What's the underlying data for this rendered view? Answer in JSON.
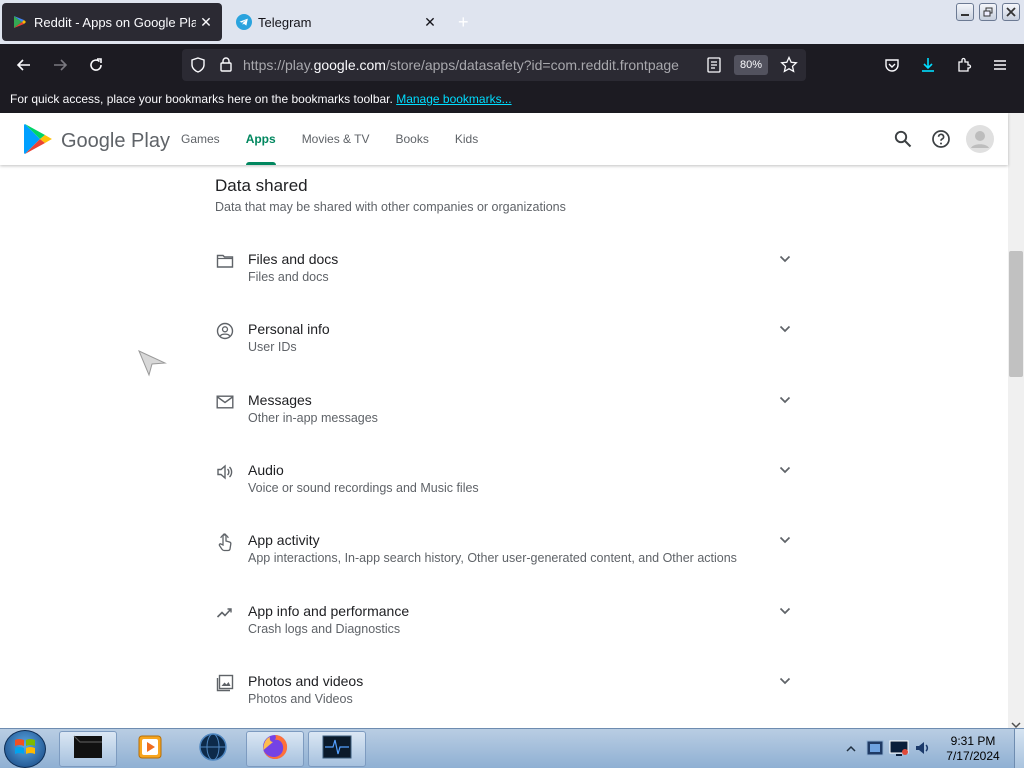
{
  "browser": {
    "tabs": [
      {
        "title": "Reddit - Apps on Google Play",
        "active": true
      },
      {
        "title": "Telegram",
        "active": false
      }
    ],
    "url_prefix": "https://play.",
    "url_domain": "google.com",
    "url_path": "/store/apps/datasafety?id=com.reddit.frontpage",
    "zoom": "80%",
    "bookmarks_hint": "For quick access, place your bookmarks here on the bookmarks toolbar.",
    "bookmarks_link": "Manage bookmarks..."
  },
  "gp": {
    "logo_text": "Google Play",
    "nav": [
      "Games",
      "Apps",
      "Movies & TV",
      "Books",
      "Kids"
    ],
    "active_nav": "Apps",
    "accent": "#01875f"
  },
  "section": {
    "title": "Data shared",
    "subtitle": "Data that may be shared with other companies or organizations",
    "items": [
      {
        "icon": "folder-icon",
        "title": "Files and docs",
        "sub": "Files and docs"
      },
      {
        "icon": "person-icon",
        "title": "Personal info",
        "sub": "User IDs"
      },
      {
        "icon": "mail-icon",
        "title": "Messages",
        "sub": "Other in-app messages"
      },
      {
        "icon": "speaker-icon",
        "title": "Audio",
        "sub": "Voice or sound recordings and Music files"
      },
      {
        "icon": "touch-icon",
        "title": "App activity",
        "sub": "App interactions, In-app search history, Other user-generated content, and Other actions"
      },
      {
        "icon": "activity-icon",
        "title": "App info and performance",
        "sub": "Crash logs and Diagnostics"
      },
      {
        "icon": "image-icon",
        "title": "Photos and videos",
        "sub": "Photos and Videos"
      }
    ]
  },
  "taskbar": {
    "time": "9:31 PM",
    "date": "7/17/2024"
  }
}
